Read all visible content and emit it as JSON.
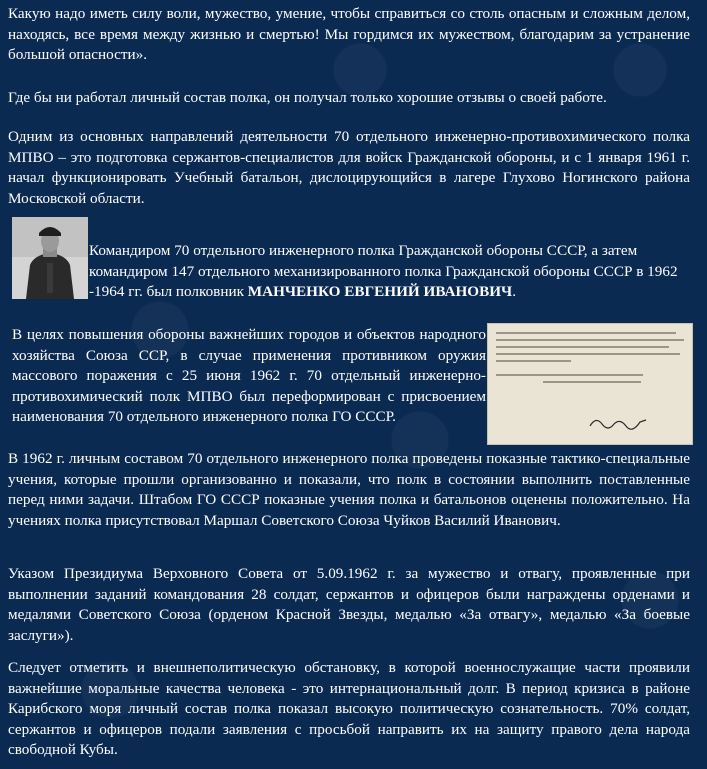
{
  "paragraphs": {
    "p1": "Какую надо иметь силу воли, мужество, умение, чтобы справиться со столь опасным и сложным делом, находясь, все время между жизнью и  смертью! Мы гордимся их мужеством, благодарим за устранение большой опасности».",
    "p2": "Где бы ни работал личный состав полка, он получал только хорошие отзывы о своей работе.",
    "p3": "Одним из основных направлений деятельности 70  отдельного инженерно-противохимического полка МПВО – это  подготовка сержантов-специалистов для войск Гражданской обороны,  и  с 1 января 1961 г.  начал функционировать  Учебный батальон, дислоцирующийся в лагере Глухово Ногинского района Московской области.",
    "p4_text": "Командиром 70 отдельного инженерного полка Гражданской обороны СССР, а  затем командиром 147 отдельного механизированного полка Гражданской обороны СССР в   1962 -1964 гг. был полковник ",
    "p4_name": "МАНЧЕНКО ЕВГЕНИЙ ИВАНОВИЧ",
    "p4_end": ".",
    "p5": "В целях повышения обороны важнейших городов и объектов народного хозяйства Союза ССР, в случае применения противником оружия массового поражения   с 25 июня 1962 г. 70 отдельный инженерно-противохимический полк МПВО был переформирован с присвоением наименования 70 отдельного инженерного полка ГО СССР.",
    "p6": "В 1962 г. личным составом 70 отдельного инженерного полка проведены показные тактико-специальные учения, которые прошли организованно и показали, что полк в состоянии выполнить поставленные перед ними задачи. Штабом ГО СССР показные учения полка и батальонов оценены положительно. На  учениях полка присутствовал Маршал Советского Союза Чуйков Василий Иванович.",
    "p7": "Указом Президиума Верховного Совета от 5.09.1962 г. за мужество и отвагу, проявленные при выполнении заданий командования 28 солдат, сержантов и офицеров были награждены орденами и медалями Советского Союза (орденом  Красной Звезды, медалью «За отвагу», медалью «За боевые заслуги»).",
    "p8": "Следует отметить и внешнеполитическую обстановку, в которой военнослужащие части проявили важнейшие моральные качества человека -  это интернациональный долг. В период кризиса в районе Карибского моря личный состав полка показал высокую политическую сознательность. 70% солдат, сержантов и офицеров  подали заявления с просьбой направить их на защиту правого дела народа свободной Кубы."
  },
  "colors": {
    "background": "#0b2a52",
    "text": "#ffffff"
  }
}
